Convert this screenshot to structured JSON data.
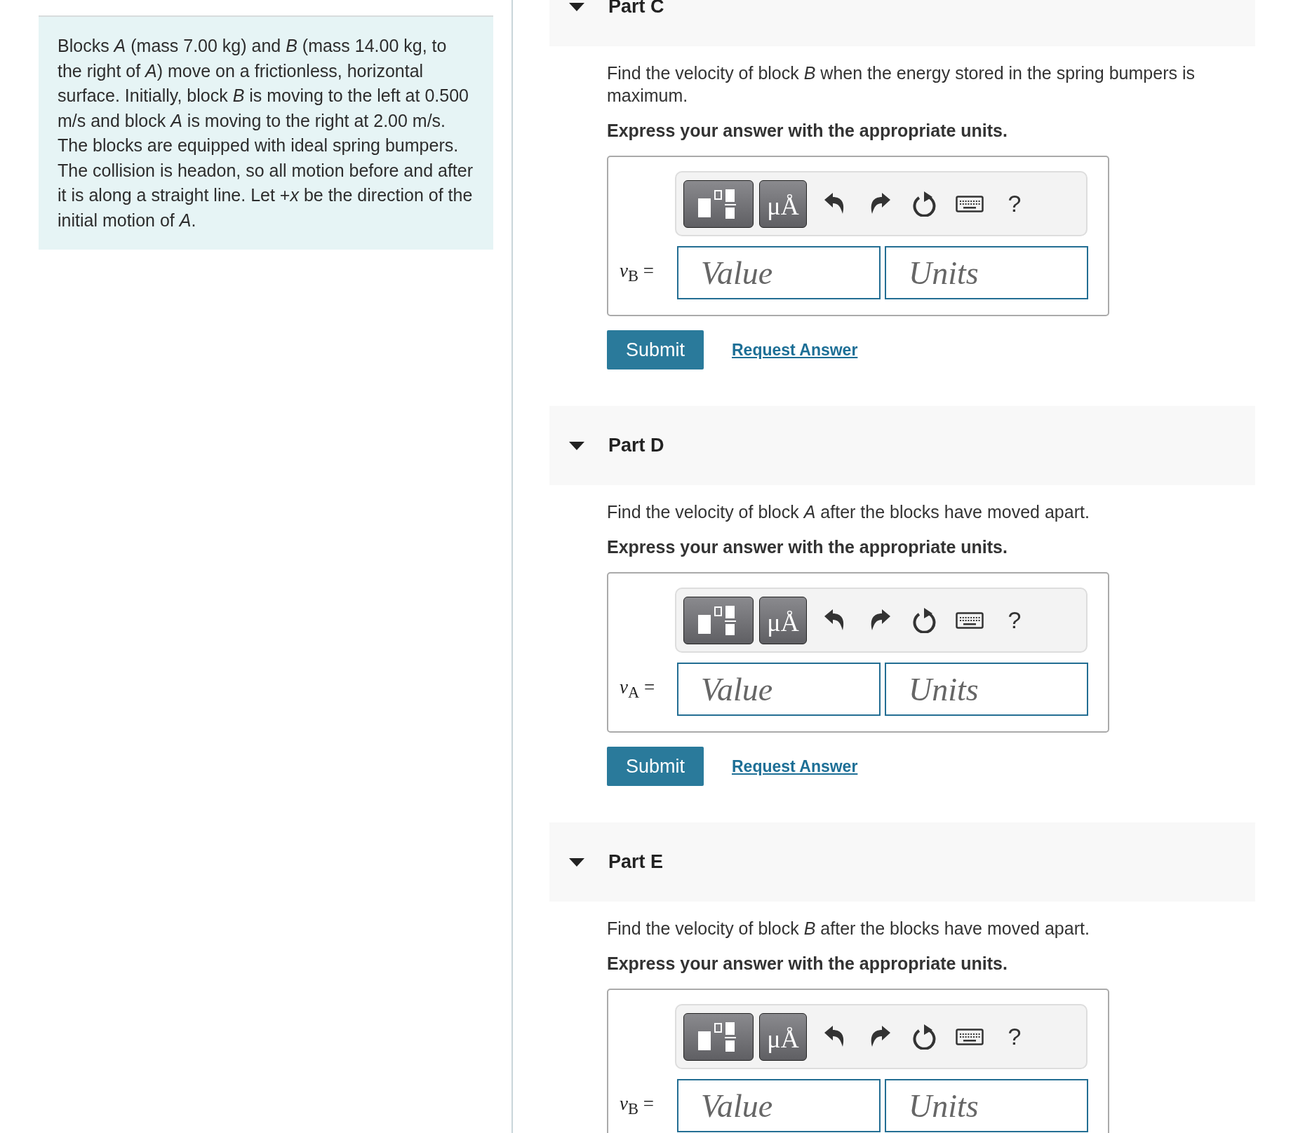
{
  "problem": {
    "text": "Blocks *A* (mass 7.00 kg) and *B* (mass 14.00 kg, to the right of *A*) move on a frictionless, horizontal surface. Initially, block *B* is moving to the left at 0.500 m/s and block *A* is moving to the right at 2.00 m/s. The blocks are equipped with ideal spring bumpers. The collision is headon, so all motion before and after it is along a straight line. Let +*x* be the direction of the initial motion of *A*."
  },
  "parts": [
    {
      "title": "Part C",
      "expanded": true,
      "prompt": "Find the velocity of block *B* when the energy stored in the spring bumpers is maximum.",
      "instruction": "Express your answer with the appropriate units.",
      "toolbar": {
        "symbols": "μÅ",
        "help": "?"
      },
      "answer_label": "*v*$_{B}$ =",
      "value_placeholder": "Value",
      "units_placeholder": "Units",
      "submit": "Submit",
      "request_answer": "Request Answer"
    },
    {
      "title": "Part D",
      "expanded": true,
      "prompt": "Find the velocity of block *A* after the blocks have moved apart.",
      "instruction": "Express your answer with the appropriate units.",
      "toolbar": {
        "symbols": "μÅ",
        "help": "?"
      },
      "answer_label": "*v*$_{A}$ =",
      "value_placeholder": "Value",
      "units_placeholder": "Units",
      "submit": "Submit",
      "request_answer": "Request Answer"
    },
    {
      "title": "Part E",
      "expanded": true,
      "prompt": "Find the velocity of block *B* after the blocks have moved apart.",
      "instruction": "Express your answer with the appropriate units.",
      "toolbar": {
        "symbols": "μÅ",
        "help": "?"
      },
      "answer_label": "*v*$_{B}$ =",
      "value_placeholder": "Value",
      "units_placeholder": "Units"
    }
  ]
}
